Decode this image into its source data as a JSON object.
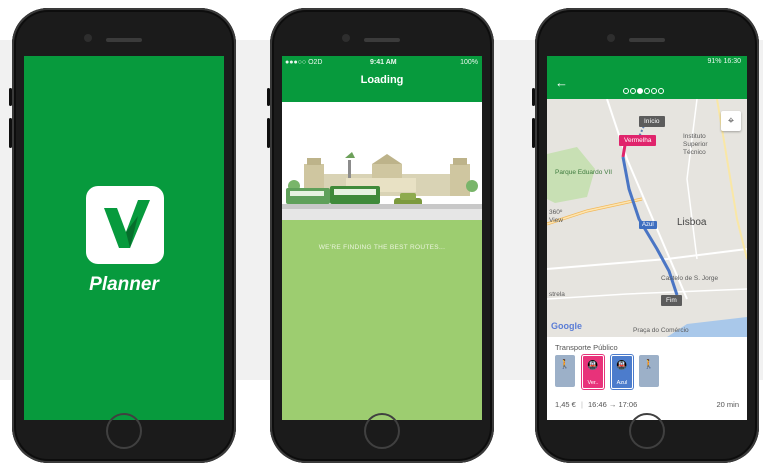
{
  "colors": {
    "brand_green": "#079a3d",
    "loading_green": "#9dcd70",
    "line_pink": "#e0246c",
    "line_blue": "#3f6fc0"
  },
  "phone1": {
    "app_icon": "v-logo-icon",
    "app_name": "Planner"
  },
  "phone2": {
    "status": {
      "carrier": "●●●○○ O2D",
      "time": "9:41 AM",
      "battery": "100%"
    },
    "title": "Loading",
    "message": "WE'RE FINDING THE BEST ROUTES..."
  },
  "phone3": {
    "status": "91% 16:30",
    "step_count": 6,
    "active_step": 2,
    "map": {
      "start_label": "Início",
      "end_label": "Fim",
      "pink_line_label": "Vermelha",
      "blue_line_label": "Azul",
      "places": {
        "instituto": "Instituto\nSuperior\nTécnico",
        "parque": "Parque Eduardo VII",
        "view": "360º\nView",
        "lisboa": "Lisboa",
        "castelo": "Castelo de S. Jorge",
        "estrela": "strela",
        "praca": "Praça do Comércio"
      },
      "attribution": "Google"
    },
    "panel": {
      "title": "Transporte Público",
      "legs": [
        {
          "type": "walk",
          "label": ""
        },
        {
          "type": "metro",
          "label": "Ver..",
          "color": "#e8327a"
        },
        {
          "type": "metro",
          "label": "Azul",
          "color": "#4c7ccc"
        },
        {
          "type": "walk",
          "label": ""
        }
      ],
      "price": "1,45 €",
      "depart": "16:46",
      "arrow": "→",
      "arrive": "17:06",
      "duration": "20 min"
    }
  }
}
